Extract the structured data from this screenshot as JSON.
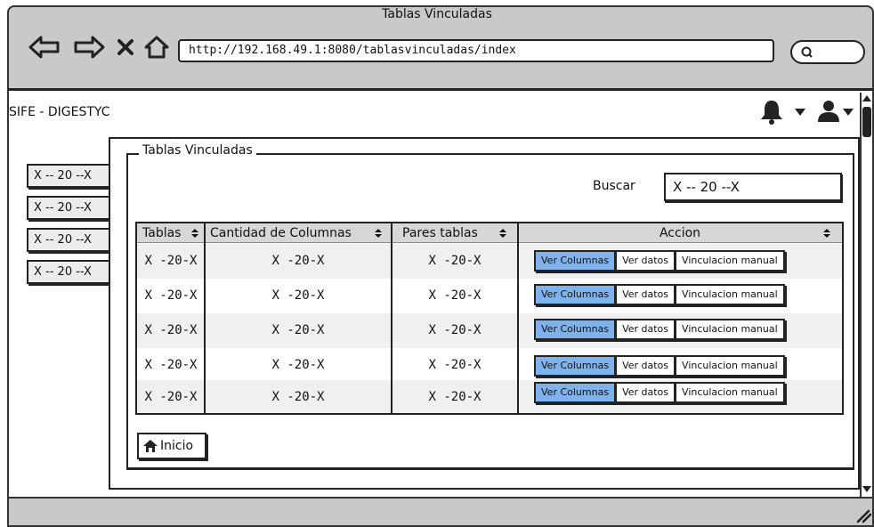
{
  "window": {
    "title": "Tablas Vinculadas"
  },
  "browser": {
    "url": "http://192.168.49.1:8080/tablasvinculadas/index"
  },
  "app": {
    "title": "SIFE - DIGESTYC"
  },
  "sidebar": {
    "items": [
      "X -- 20 --X",
      "X -- 20 --X",
      "X -- 20 --X",
      "X -- 20 --X"
    ]
  },
  "panel": {
    "title": "Tablas Vinculadas"
  },
  "search": {
    "label": "Buscar",
    "value": "X -- 20 --X"
  },
  "table": {
    "headers": [
      "Tablas",
      "Cantidad de Columnas",
      "Pares tablas",
      "Accion"
    ],
    "rows": [
      {
        "tablas": "X -20-X",
        "cantidad": "X -20-X",
        "pares": "X -20-X"
      },
      {
        "tablas": "X -20-X",
        "cantidad": "X -20-X",
        "pares": "X -20-X"
      },
      {
        "tablas": "X -20-X",
        "cantidad": "X -20-X",
        "pares": "X -20-X"
      },
      {
        "tablas": "X -20-X",
        "cantidad": "X -20-X",
        "pares": "X -20-X"
      },
      {
        "tablas": "X -20-X",
        "cantidad": "X -20-X",
        "pares": "X -20-X"
      }
    ],
    "actions": {
      "ver_columnas": "Ver Columnas",
      "ver_datos": "Ver datos",
      "vinculacion_manual": "Vinculacion manual"
    }
  },
  "footer": {
    "inicio_label": "Inicio"
  },
  "colors": {
    "primary_button": "#7fb1ea",
    "chrome": "#c9c9c9",
    "header_bg": "#d7d7d7"
  }
}
